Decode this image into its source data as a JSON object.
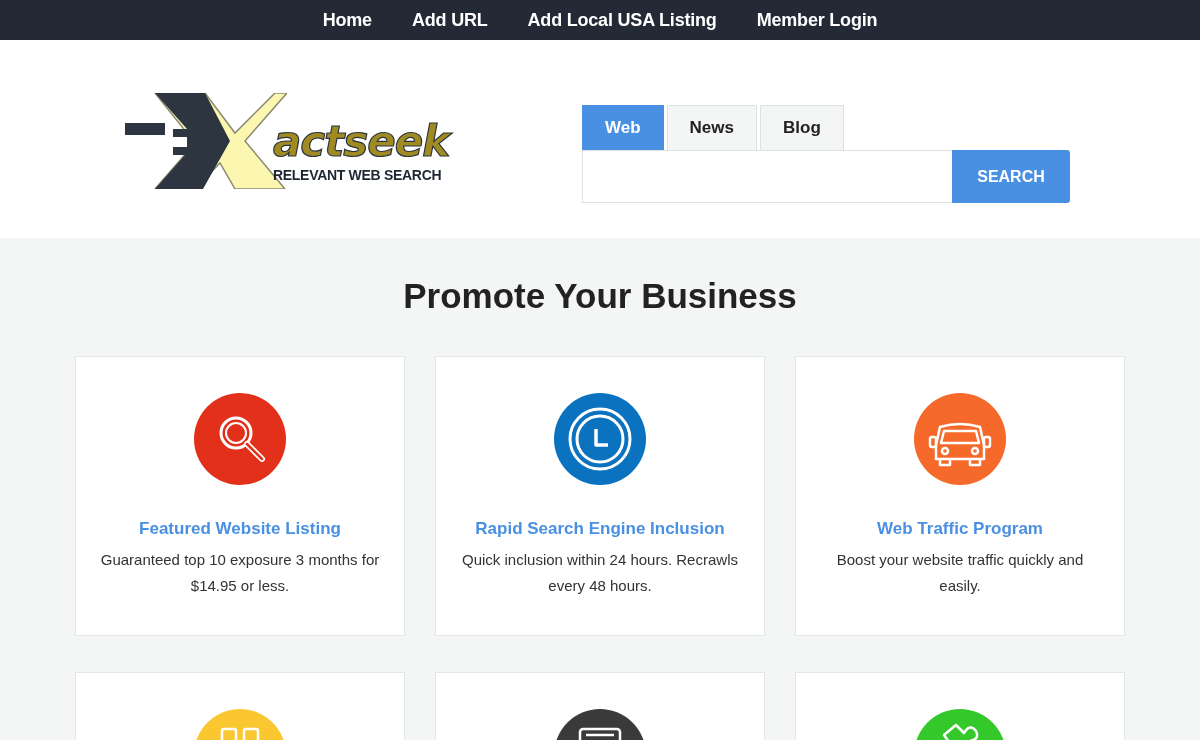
{
  "nav": {
    "links": [
      "Home",
      "Add URL",
      "Add Local USA Listing",
      "Member Login"
    ]
  },
  "logo": {
    "word": "actseek",
    "tagline": "RELEVANT WEB SEARCH"
  },
  "search": {
    "tabs": [
      {
        "label": "Web",
        "selected": true
      },
      {
        "label": "News",
        "selected": false
      },
      {
        "label": "Blog",
        "selected": false
      }
    ],
    "button": "SEARCH"
  },
  "promo": {
    "heading": "Promote Your Business",
    "cards": [
      {
        "color": "#e2301a",
        "title": "Featured Website Listing",
        "text": "Guaranteed top 10 exposure 3 months for $14.95 or less."
      },
      {
        "color": "#0a72bf",
        "title": "Rapid Search Engine Inclusion",
        "text": "Quick inclusion within 24 hours. Recrawls every 48 hours."
      },
      {
        "color": "#f56a2a",
        "title": "Web Traffic Program",
        "text": "Boost your website traffic quickly and easily."
      },
      {
        "color": "#fbc730"
      },
      {
        "color": "#3a3a3a"
      },
      {
        "color": "#35c82a"
      }
    ]
  }
}
